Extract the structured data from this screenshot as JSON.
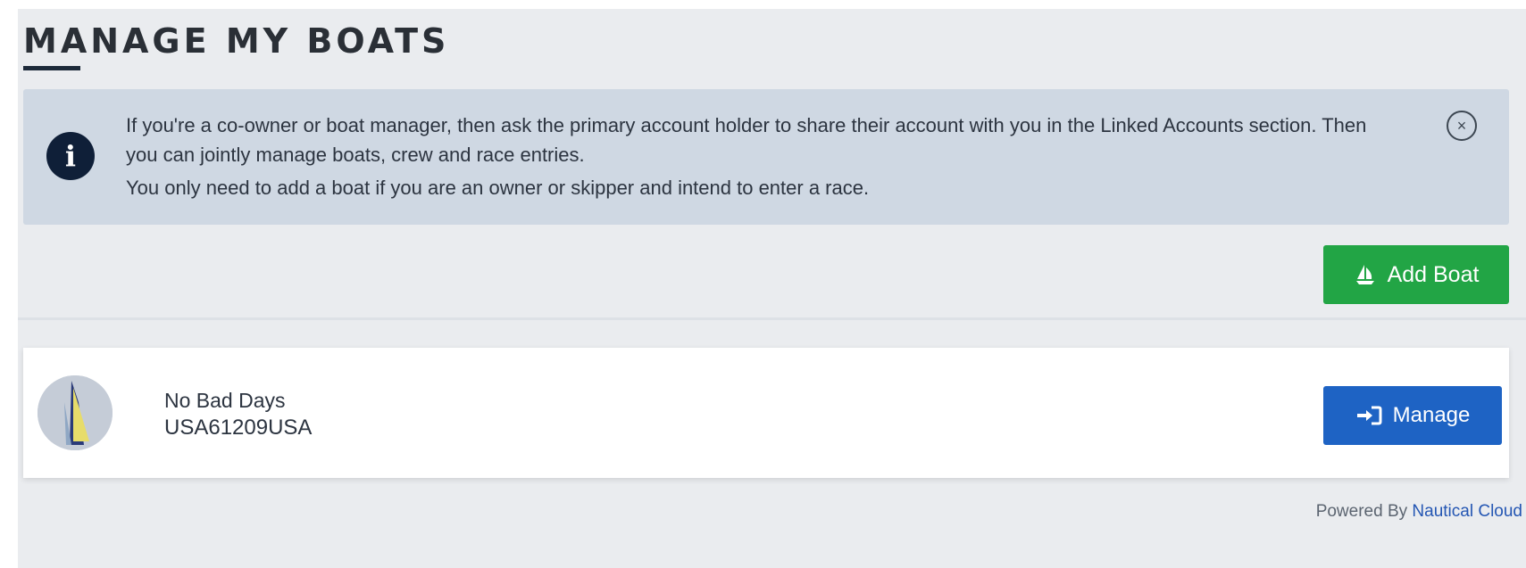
{
  "page": {
    "title": "MANAGE MY BOATS"
  },
  "info": {
    "line1": "If you're a co-owner or boat manager, then ask the primary account holder to share their account with you in the Linked Accounts section. Then you can jointly manage boats, crew and race entries.",
    "line2": "You only need to add a boat if you are an owner or skipper and intend to enter a race.",
    "icon_glyph": "i",
    "close_glyph": "×"
  },
  "actions": {
    "add_boat_label": "Add Boat"
  },
  "boats": [
    {
      "name": "No Bad Days",
      "sail_number": "USA61209USA",
      "manage_label": "Manage"
    }
  ],
  "footer": {
    "powered_prefix": "Powered By",
    "powered_link": "Nautical Cloud"
  },
  "icons": {
    "info": "info-circle-icon",
    "close": "close-circle-icon",
    "add_boat": "sailboat-icon",
    "manage": "sign-in-icon"
  },
  "colors": {
    "add_boat_button": "#22a545",
    "manage_button": "#1e63c4",
    "info_background": "#cfd8e3",
    "info_icon": "#0f1f38",
    "link": "#2456b3"
  }
}
